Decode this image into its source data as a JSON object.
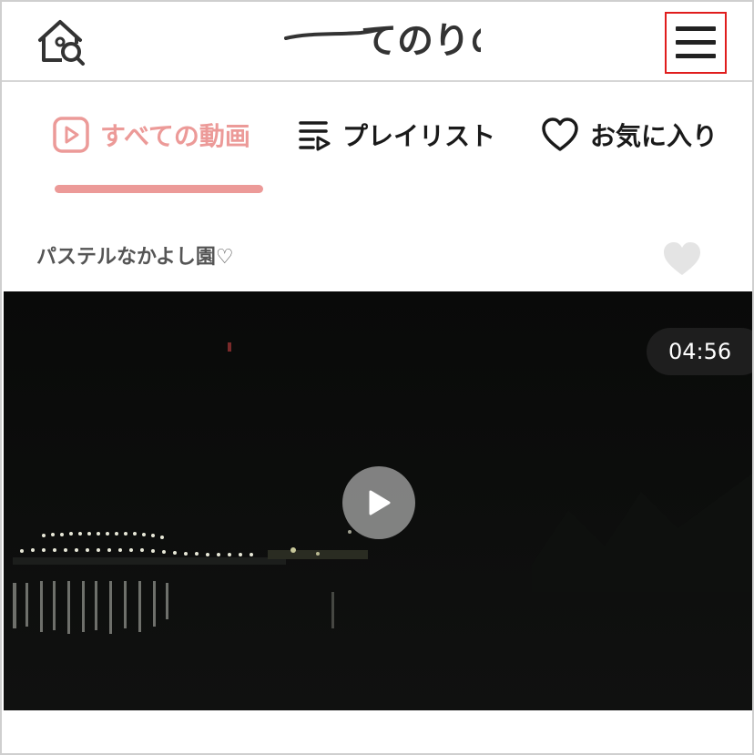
{
  "header": {
    "logo_text": "てのりの",
    "home_search_icon": "home-search-icon",
    "menu_icon": "hamburger-menu-icon"
  },
  "tabs": [
    {
      "label": "すべての動画",
      "icon": "play-square-icon",
      "active": true
    },
    {
      "label": "プレイリスト",
      "icon": "playlist-icon",
      "active": false
    },
    {
      "label": "お気に入り",
      "icon": "heart-outline-icon",
      "active": false
    }
  ],
  "section": {
    "title": "パステルなかよし園♡"
  },
  "video": {
    "duration": "04:56",
    "play_icon": "play-icon"
  },
  "colors": {
    "accent": "#ec9a98",
    "menu_highlight": "#e01d1d",
    "text": "#1a1a1a"
  }
}
